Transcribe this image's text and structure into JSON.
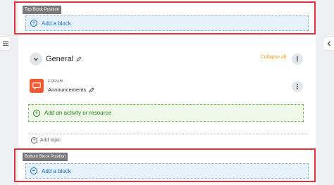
{
  "top_region": {
    "title": "Top Block Position",
    "add_block_label": "Add a block"
  },
  "section": {
    "title": "General",
    "collapse_all_label": "Collapse all"
  },
  "activity": {
    "type_label": "FORUM",
    "name": "Announcements"
  },
  "add_activity_label": "Add an activity or resource",
  "add_topic_label": "Add topic",
  "bottom_region": {
    "title": "Bottom Block Position",
    "add_block_label": "Add a block"
  },
  "colors": {
    "region_border": "#e5313a",
    "link_blue": "#0f6cbf",
    "forum_orange": "#f05a32",
    "collapse_all": "#e49b1b",
    "add_activity_green": "#2a7a1c"
  },
  "icons": {
    "left_drawer": "list-icon",
    "right_drawer": "chevron-left-icon",
    "add": "plus-circle-icon",
    "edit": "pencil-icon",
    "menu": "kebab-icon",
    "forum": "forum-icon",
    "collapse": "chevron-down-icon"
  }
}
